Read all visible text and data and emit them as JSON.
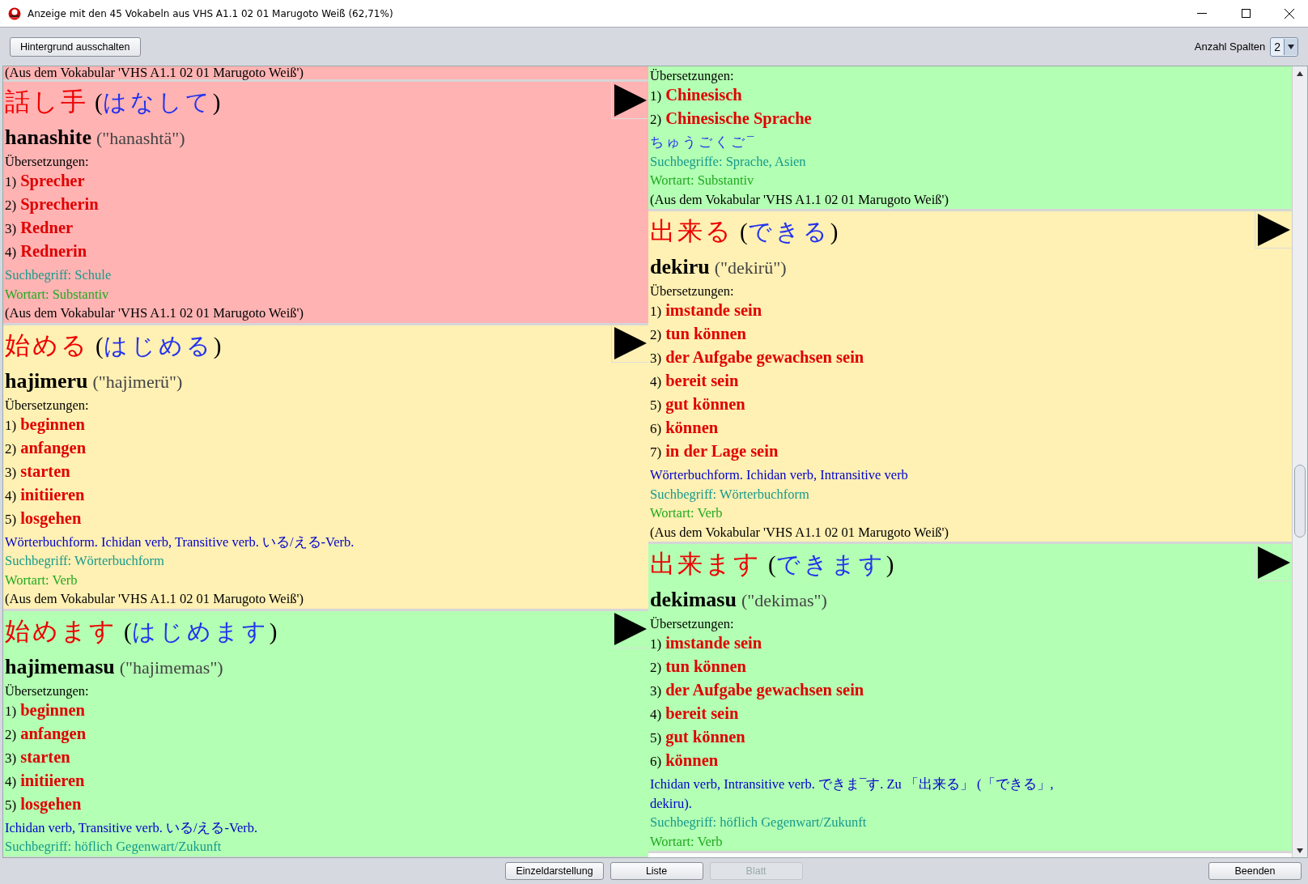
{
  "window": {
    "title": "Anzeige mit den 45 Vokabeln aus VHS A1.1 02 01 Marugoto Weiß (62,71%)"
  },
  "toolbar": {
    "background_button": "Hintergrund ausschalten",
    "columns_label": "Anzahl Spalten",
    "columns_value": "2"
  },
  "columns": [
    [
      {
        "color": "#ffb3b3",
        "source": "(Aus dem Vokabular 'VHS A1.1 02 01 Marugoto Weiß')"
      },
      {
        "color": "#ffb3b3",
        "kanji": "話し手",
        "kana": "(はなして)",
        "romaji": "hanashite",
        "pronunciation": "(\"hanashtä\")",
        "translations_label": "Übersetzungen:",
        "translations": [
          {
            "number": "1)",
            "text": "Sprecher"
          },
          {
            "number": "2)",
            "text": "Sprecherin"
          },
          {
            "number": "3)",
            "text": "Redner"
          },
          {
            "number": "4)",
            "text": "Rednerin"
          }
        ],
        "search": "Suchbegriff: Schule",
        "word_type": "Wortart: Substantiv",
        "source": "(Aus dem Vokabular 'VHS A1.1 02 01 Marugoto Weiß')"
      },
      {
        "color": "#fff0b3",
        "kanji": "始める",
        "kana": "(はじめる)",
        "romaji": "hajimeru",
        "pronunciation": "(\"hajimerü\")",
        "translations_label": "Übersetzungen:",
        "translations": [
          {
            "number": "1)",
            "text": "beginnen"
          },
          {
            "number": "2)",
            "text": "anfangen"
          },
          {
            "number": "3)",
            "text": "starten"
          },
          {
            "number": "4)",
            "text": "initiieren"
          },
          {
            "number": "5)",
            "text": "losgehen"
          }
        ],
        "grammar": "Wörterbuchform. Ichidan verb, Transitive verb. いる/える-Verb.",
        "search": "Suchbegriff: Wörterbuchform",
        "word_type": "Wortart: Verb",
        "source": "(Aus dem Vokabular 'VHS A1.1 02 01 Marugoto Weiß')"
      },
      {
        "color": "#b3ffb3",
        "kanji": "始めます",
        "kana": "(はじめます)",
        "romaji": "hajimemasu",
        "pronunciation": "(\"hajimemas\")",
        "translations_label": "Übersetzungen:",
        "translations": [
          {
            "number": "1)",
            "text": "beginnen"
          },
          {
            "number": "2)",
            "text": "anfangen"
          },
          {
            "number": "3)",
            "text": "starten"
          },
          {
            "number": "4)",
            "text": "initiieren"
          },
          {
            "number": "5)",
            "text": "losgehen"
          }
        ],
        "grammar": "Ichidan verb, Transitive verb. いる/える-Verb.",
        "search": "Suchbegriff: höflich Gegenwart/Zukunft"
      }
    ],
    [
      {
        "color": "#b3ffb3",
        "translations_label": "Übersetzungen:",
        "translations": [
          {
            "number": "1)",
            "text": "Chinesisch"
          },
          {
            "number": "2)",
            "text": "Chinesische Sprache"
          }
        ],
        "reading": "ちゅうごくご¯",
        "search": "Suchbegriffe: Sprache, Asien",
        "word_type": "Wortart: Substantiv",
        "source": "(Aus dem Vokabular 'VHS A1.1 02 01 Marugoto Weiß')"
      },
      {
        "color": "#fff0b3",
        "kanji": "出来る",
        "kana": "(できる)",
        "romaji": "dekiru",
        "pronunciation": "(\"dekirü\")",
        "translations_label": "Übersetzungen:",
        "translations": [
          {
            "number": "1)",
            "text": "imstande sein"
          },
          {
            "number": "2)",
            "text": "tun können"
          },
          {
            "number": "3)",
            "text": "der Aufgabe gewachsen sein"
          },
          {
            "number": "4)",
            "text": "bereit sein"
          },
          {
            "number": "5)",
            "text": "gut können"
          },
          {
            "number": "6)",
            "text": "können"
          },
          {
            "number": "7)",
            "text": "in der Lage sein"
          }
        ],
        "grammar": "Wörterbuchform. Ichidan verb, Intransitive verb",
        "search": "Suchbegriff: Wörterbuchform",
        "word_type": "Wortart: Verb",
        "source": "(Aus dem Vokabular 'VHS A1.1 02 01 Marugoto Weiß')"
      },
      {
        "color": "#b3ffb3",
        "kanji": "出来ます",
        "kana": "(できます)",
        "romaji": "dekimasu",
        "pronunciation": "(\"dekimas\")",
        "translations_label": "Übersetzungen:",
        "translations": [
          {
            "number": "1)",
            "text": "imstande sein"
          },
          {
            "number": "2)",
            "text": "tun können"
          },
          {
            "number": "3)",
            "text": "der Aufgabe gewachsen sein"
          },
          {
            "number": "4)",
            "text": "bereit sein"
          },
          {
            "number": "5)",
            "text": "gut können"
          },
          {
            "number": "6)",
            "text": "können"
          }
        ],
        "grammar": "Ichidan verb, Intransitive verb. できま¯す. Zu 「出来る」 (「できる」, dekiru).",
        "search": "Suchbegriff: höflich Gegenwart/Zukunft",
        "word_type": "Wortart: Verb"
      }
    ]
  ],
  "bottom_buttons": [
    {
      "label": "Einzeldarstellung",
      "disabled": false
    },
    {
      "label": "Liste",
      "disabled": false
    },
    {
      "label": "Blatt",
      "disabled": true
    }
  ],
  "exit_button": "Beenden"
}
